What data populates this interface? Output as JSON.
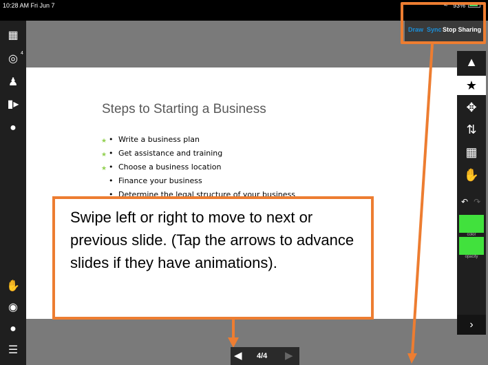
{
  "status_bar": {
    "time": "10:28 AM  Fri Jun 7",
    "battery": "93%"
  },
  "share_bar": {
    "draw_label": "Draw",
    "sync_label": "Sync",
    "stop_label": "Stop Sharing"
  },
  "left_toolbar": {
    "badge": "4",
    "items": [
      "presentation-icon",
      "target-icon",
      "participants-icon",
      "video-icon",
      "chat-icon",
      "raise-hand-icon",
      "webcam-icon",
      "microphone-icon",
      "menu-icon"
    ]
  },
  "slide": {
    "title": "Steps to Starting a Business",
    "bullets": [
      "Write a business plan",
      "Get assistance and training",
      "Choose a business location",
      "Finance your business",
      "Determine the legal structure of your business"
    ]
  },
  "right_toolbar": {
    "tools": [
      "highlighter-icon",
      "star-icon",
      "move-icon",
      "layers-icon",
      "trash-icon",
      "hand-icon"
    ],
    "color_label": "color",
    "opacity_label": "opacity",
    "color": "#41e13d"
  },
  "callout": {
    "text": "Swipe left or right to move to next or previous slide.  (Tap the arrows to advance slides if they have animations)."
  },
  "nav": {
    "page": "4/4"
  },
  "colors": {
    "annotation": "#ed7d31",
    "accent": "#1b8ed8"
  }
}
